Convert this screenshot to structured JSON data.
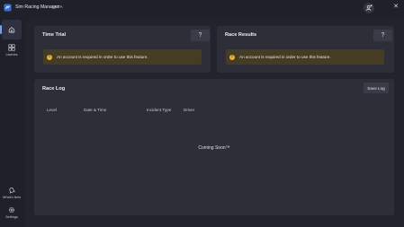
{
  "app": {
    "title": "Sim Racing Manager",
    "badge": "BETA"
  },
  "titlebar": {
    "close_glyph": "✕",
    "user_icon": "user-add-icon"
  },
  "sidebar": {
    "items": [
      {
        "id": "home",
        "label": "",
        "icon": "home-icon",
        "active": true
      },
      {
        "id": "liveries",
        "label": "Liveries",
        "icon": "grid-icon",
        "active": false
      },
      {
        "id": "whats-new",
        "label": "What's New",
        "icon": "bell-icon",
        "active": false
      },
      {
        "id": "settings",
        "label": "Settings",
        "icon": "gear-icon",
        "active": false
      }
    ]
  },
  "time_trial": {
    "title": "Time Trial",
    "help": "?",
    "warning": "An account is required in order to use this feature."
  },
  "race_results": {
    "title": "Race Results",
    "help": "?",
    "warning": "An account is required in order to use this feature."
  },
  "race_log": {
    "title": "Race Log",
    "save_label": "Save Log",
    "columns": [
      "Level",
      "Date & Time",
      "Incident Type",
      "Driver"
    ],
    "empty_message": "Coming Soon™"
  },
  "colors": {
    "accent": "#6aa5f2",
    "warning": "#e3b23c",
    "warning_bg": "#443c23",
    "background": "#1f2029",
    "card": "#2d2e38"
  }
}
